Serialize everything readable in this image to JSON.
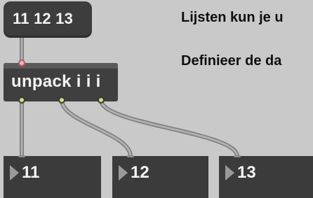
{
  "message_box": {
    "text": "11 12 13"
  },
  "unpack_object": {
    "text": "unpack i i i"
  },
  "number_boxes": [
    {
      "value": "11"
    },
    {
      "value": "12"
    },
    {
      "value": "13"
    }
  ],
  "comments": [
    "Lijsten kun je u",
    "Definieer de da"
  ],
  "colors": {
    "canvas": "#c9c9c9",
    "object_bg": "#3f3f3f",
    "cord": "#9a9a9a",
    "outlet": "#cfe07a",
    "inlet": "#f6b5b5"
  }
}
